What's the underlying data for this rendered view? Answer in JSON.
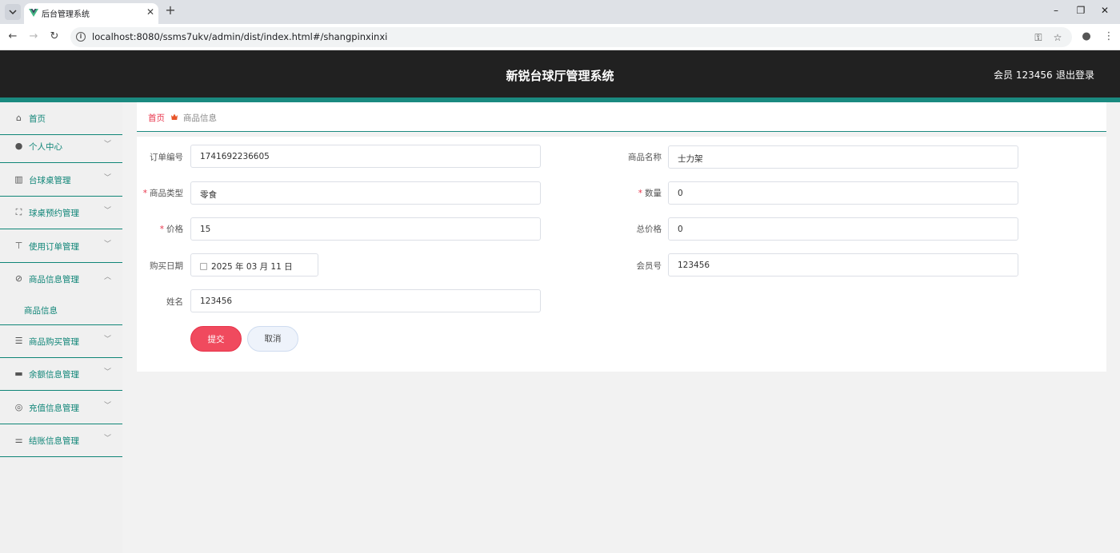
{
  "browser": {
    "tab_title": "后台管理系统",
    "url": "localhost:8080/ssms7ukv/admin/dist/index.html#/shangpinxinxi"
  },
  "header": {
    "title": "新锐台球厅管理系统",
    "user": "会员 123456",
    "logout": "退出登录"
  },
  "sidebar": {
    "items": [
      {
        "label": "首页",
        "icon": "home-icon"
      },
      {
        "label": "个人中心",
        "icon": "user-icon"
      },
      {
        "label": "台球桌管理",
        "icon": "library-icon"
      },
      {
        "label": "球桌预约管理",
        "icon": "fullscreen-icon"
      },
      {
        "label": "使用订单管理",
        "icon": "stamp-icon"
      },
      {
        "label": "商品信息管理",
        "icon": "bell-off-icon"
      },
      {
        "label": "商品购买管理",
        "icon": "list-icon"
      },
      {
        "label": "余额信息管理",
        "icon": "ticket-icon"
      },
      {
        "label": "充值信息管理",
        "icon": "lifebuoy-icon"
      },
      {
        "label": "结账信息管理",
        "icon": "sliders-icon"
      }
    ],
    "sub_item": "商品信息"
  },
  "breadcrumb": {
    "home": "首页",
    "current": "商品信息"
  },
  "form": {
    "order_no": {
      "label": "订单编号",
      "value": "1741692236605"
    },
    "product_name": {
      "label": "商品名称",
      "value": "士力架"
    },
    "product_type": {
      "label": "商品类型",
      "value": "零食"
    },
    "quantity": {
      "label": "数量",
      "value": "0"
    },
    "price": {
      "label": "价格",
      "value": "15"
    },
    "total_price": {
      "label": "总价格",
      "value": "0"
    },
    "purchase_date": {
      "label": "购买日期",
      "value": "2025 年 03 月 11 日"
    },
    "member_no": {
      "label": "会员号",
      "value": "123456"
    },
    "name": {
      "label": "姓名",
      "value": "123456"
    },
    "submit": "提交",
    "cancel": "取消"
  },
  "colors": {
    "accent": "#1a8a80",
    "danger": "#e8334a",
    "header_bg": "#212121"
  }
}
